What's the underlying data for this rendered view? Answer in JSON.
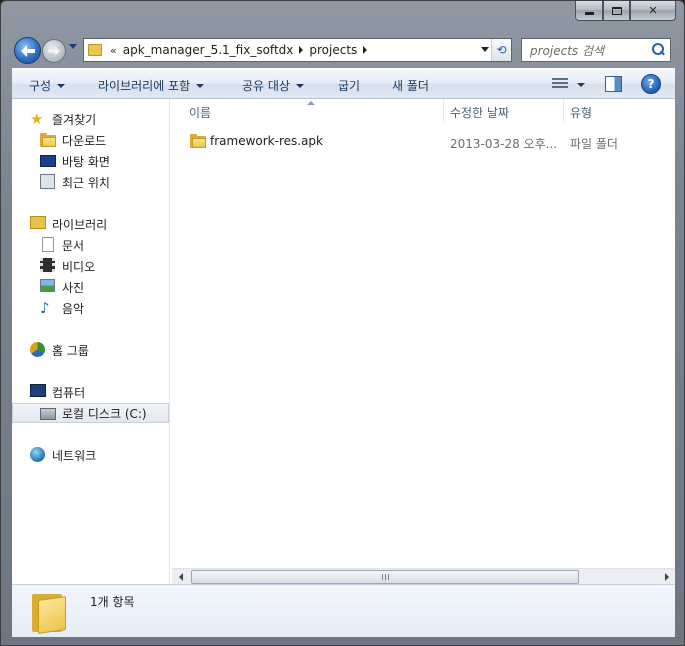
{
  "window": {
    "caption_buttons": {
      "minimize": "minimize",
      "maximize": "maximize",
      "close": "✕"
    }
  },
  "nav": {
    "address": {
      "overflow": "«",
      "segments": [
        "apk_manager_5.1_fix_softdx",
        "projects"
      ]
    },
    "search": {
      "placeholder": "projects 검색"
    }
  },
  "toolbar": {
    "organize": "구성",
    "include_in_library": "라이브러리에 포함",
    "share_with": "공유 대상",
    "burn": "굽기",
    "new_folder": "새 폴더",
    "help": "?"
  },
  "sidebar": {
    "favorites": {
      "label": "즐겨찾기",
      "items": [
        {
          "label": "다운로드",
          "icon": "download-folder-icon"
        },
        {
          "label": "바탕 화면",
          "icon": "desktop-icon"
        },
        {
          "label": "최근 위치",
          "icon": "recent-places-icon"
        }
      ]
    },
    "libraries": {
      "label": "라이브러리",
      "items": [
        {
          "label": "문서",
          "icon": "documents-icon"
        },
        {
          "label": "비디오",
          "icon": "videos-icon"
        },
        {
          "label": "사진",
          "icon": "pictures-icon"
        },
        {
          "label": "음악",
          "icon": "music-icon"
        }
      ]
    },
    "homegroup": {
      "label": "홈 그룹"
    },
    "computer": {
      "label": "컴퓨터",
      "items": [
        {
          "label": "로컬 디스크 (C:)",
          "icon": "local-disk-icon",
          "selected": true
        }
      ]
    },
    "network": {
      "label": "네트워크"
    }
  },
  "files": {
    "columns": {
      "name": "이름",
      "date_modified": "수정한 날짜",
      "type": "유형"
    },
    "rows": [
      {
        "name": "framework-res.apk",
        "date_modified": "2013-03-28 오후...",
        "type": "파일 폴더"
      }
    ]
  },
  "details": {
    "item_count": "1개 항목"
  }
}
